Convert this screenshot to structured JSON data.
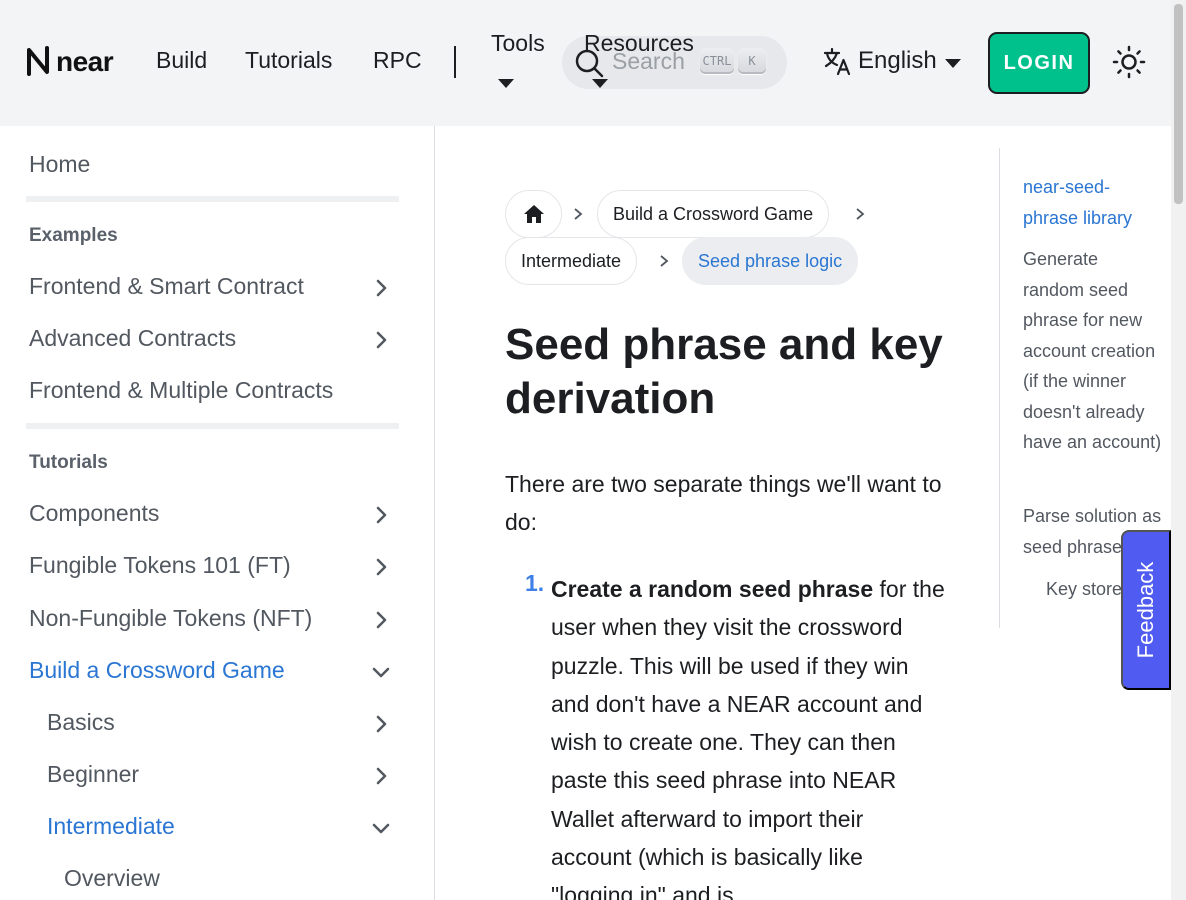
{
  "navbar": {
    "logo_text": "near",
    "links": [
      "Build",
      "Tutorials",
      "RPC"
    ],
    "dropdowns": [
      "Tools",
      "Resources"
    ],
    "search": {
      "placeholder": "Search",
      "kbd_ctrl": "CTRL",
      "kbd_k": "K"
    },
    "language": "English",
    "login_label": "LOGIN",
    "accent_color": "#00c08b"
  },
  "sidebar": {
    "home": "Home",
    "examples_title": "Examples",
    "examples": [
      "Frontend & Smart Contract",
      "Advanced Contracts",
      "Frontend & Multiple Contracts"
    ],
    "tutorials_title": "Tutorials",
    "tutorials": [
      "Components",
      "Fungible Tokens 101 (FT)",
      "Non-Fungible Tokens (NFT)",
      "Build a Crossword Game"
    ],
    "crossword_children": [
      "Basics",
      "Beginner",
      "Intermediate"
    ],
    "intermediate_children": [
      "Overview"
    ]
  },
  "breadcrumb": {
    "items": [
      "Build a Crossword Game",
      "Intermediate",
      "Seed phrase logic"
    ]
  },
  "content": {
    "title": "Seed phrase and key derivation",
    "intro": "There are two separate things we'll want to do:",
    "list_number": "1.",
    "list_bold": "Create a random seed phrase",
    "list_text": " for the user when they visit the crossword puzzle. This will be used if they win and don't have a NEAR account and wish to create one. They can then paste this seed phrase into NEAR Wallet afterward to import their account (which is basically like \"logging in\" and is"
  },
  "toc": {
    "items": [
      "near-seed-phrase library",
      "Generate random seed phrase for new account creation (if the winner doesn't already have an account)",
      "Parse solution as seed phrase",
      "Key store"
    ]
  },
  "feedback_label": "Feedback"
}
